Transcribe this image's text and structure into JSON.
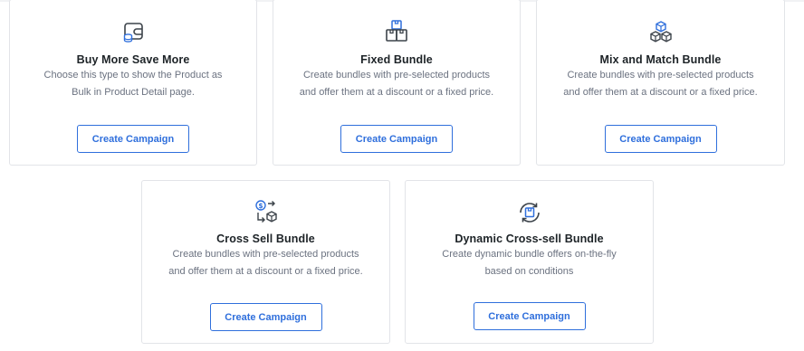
{
  "colors": {
    "accent": "#2f6fdc",
    "icon_dark": "#3c434a",
    "title": "#1d2327",
    "description": "#6b7280",
    "border": "#e2e4e8"
  },
  "cards": [
    {
      "icon": "wallet-coins-icon",
      "title": "Buy More Save More",
      "description": "Choose this type to show the Product as Bulk in Product Detail page.",
      "button_label": "Create Campaign"
    },
    {
      "icon": "boxes-bundle-icon",
      "title": "Fixed Bundle",
      "description": "Create bundles with pre-selected products and offer them at a discount or a fixed price.",
      "button_label": "Create Campaign"
    },
    {
      "icon": "stacked-cubes-icon",
      "title": "Mix and Match Bundle",
      "description": "Create bundles with pre-selected products and offer them at a discount or a fixed price.",
      "button_label": "Create Campaign"
    },
    {
      "icon": "dollar-exchange-box-icon",
      "title": "Cross Sell Bundle",
      "description": "Create bundles with pre-selected products and offer them at a discount or a fixed price.",
      "button_label": "Create Campaign"
    },
    {
      "icon": "refresh-box-icon",
      "title": "Dynamic Cross-sell Bundle",
      "description": "Create dynamic bundle offers on-the-fly based on conditions",
      "button_label": "Create Campaign"
    }
  ]
}
